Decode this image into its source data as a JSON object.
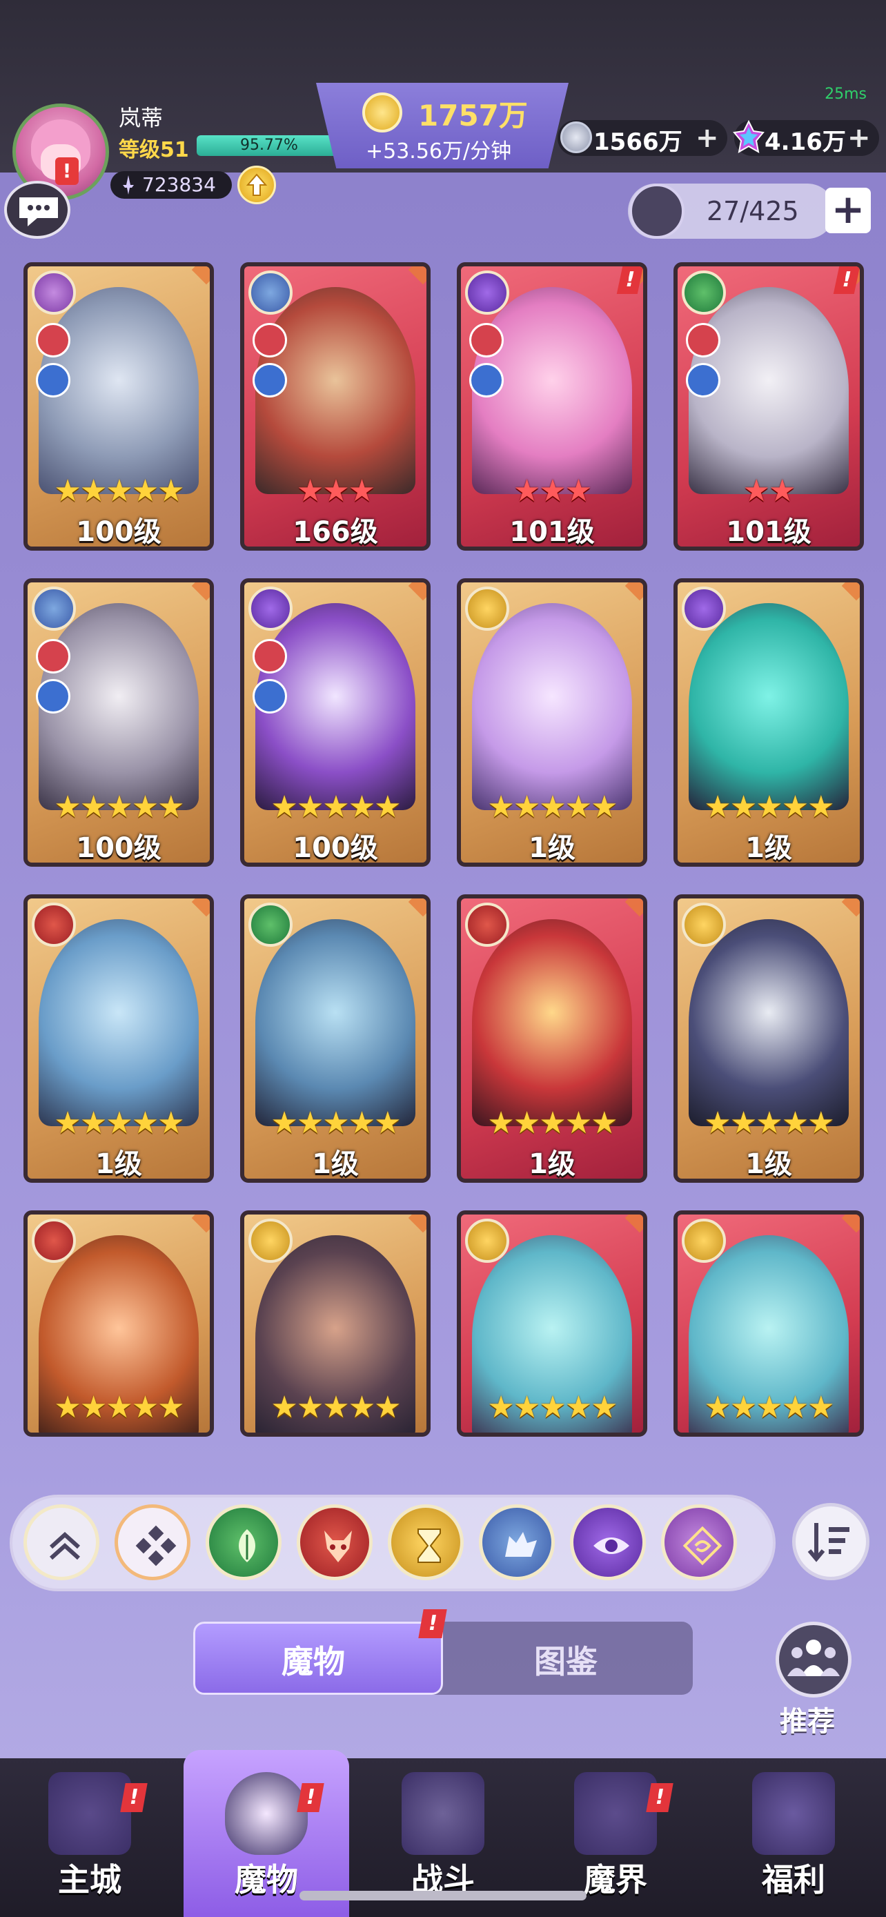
{
  "header": {
    "ping": "25ms",
    "player_name": "岚蒂",
    "player_level": "等级51",
    "xp_percent": "95.77%",
    "xp_fraction": 0.9577,
    "power": "723834",
    "gold": "1757万",
    "gold_rate": "+53.56万/分钟",
    "silver": "1566万",
    "gems": "4.16万",
    "capacity": "27/425",
    "plus": "+"
  },
  "monsters": [
    {
      "level": "100级",
      "stars": 5,
      "star_color": "gold",
      "card": "gold",
      "element": "wind",
      "new": false
    },
    {
      "level": "166级",
      "stars": 3,
      "star_color": "red",
      "card": "red",
      "element": "wolf",
      "new": false
    },
    {
      "level": "101级",
      "stars": 3,
      "star_color": "red",
      "card": "red",
      "element": "eye",
      "new": true
    },
    {
      "level": "101级",
      "stars": 2,
      "star_color": "red",
      "card": "red",
      "element": "leaf",
      "new": true
    },
    {
      "level": "100级",
      "stars": 5,
      "star_color": "gold",
      "card": "gold",
      "element": "wolf",
      "new": false
    },
    {
      "level": "100级",
      "stars": 5,
      "star_color": "gold",
      "card": "gold",
      "element": "eye",
      "new": false
    },
    {
      "level": "1级",
      "stars": 5,
      "star_color": "gold",
      "card": "gold",
      "element": "hourglass",
      "new": false
    },
    {
      "level": "1级",
      "stars": 5,
      "star_color": "gold",
      "card": "gold",
      "element": "eye",
      "new": false
    },
    {
      "level": "1级",
      "stars": 5,
      "star_color": "gold",
      "card": "gold",
      "element": "demon",
      "new": false
    },
    {
      "level": "1级",
      "stars": 5,
      "star_color": "gold",
      "card": "gold",
      "element": "leaf",
      "new": false
    },
    {
      "level": "1级",
      "stars": 5,
      "star_color": "gold",
      "card": "red",
      "element": "demon",
      "new": false
    },
    {
      "level": "1级",
      "stars": 5,
      "star_color": "gold",
      "card": "gold",
      "element": "hourglass",
      "new": false
    },
    {
      "level": "",
      "stars": 5,
      "star_color": "gold",
      "card": "gold",
      "element": "demon",
      "new": false
    },
    {
      "level": "",
      "stars": 5,
      "star_color": "gold",
      "card": "gold",
      "element": "hourglass",
      "new": false
    },
    {
      "level": "",
      "stars": 5,
      "star_color": "gold",
      "card": "red",
      "element": "hourglass",
      "new": false
    },
    {
      "level": "",
      "stars": 5,
      "star_color": "gold",
      "card": "red",
      "element": "hourglass",
      "new": false
    }
  ],
  "filters": [
    "collapse",
    "all",
    "leaf",
    "demon",
    "hourglass",
    "wolf",
    "eye",
    "wind"
  ],
  "tabs": {
    "monsters": "魔物",
    "codex": "图鉴",
    "recommend": "推荐",
    "badge": "!"
  },
  "nav": [
    {
      "label": "主城",
      "icon": "castle-icon",
      "badge": true
    },
    {
      "label": "魔物",
      "icon": "monster-flame-icon",
      "badge": true,
      "active": true
    },
    {
      "label": "战斗",
      "icon": "sword-shield-icon",
      "badge": false
    },
    {
      "label": "魔界",
      "icon": "portal-icon",
      "badge": true
    },
    {
      "label": "福利",
      "icon": "treasure-chest-icon",
      "badge": false
    }
  ],
  "colors": {
    "background": "#9b8fd6",
    "gold_text": "#ffd84a",
    "badge_red": "#e3353b",
    "active_tab": "#8b6be8"
  }
}
